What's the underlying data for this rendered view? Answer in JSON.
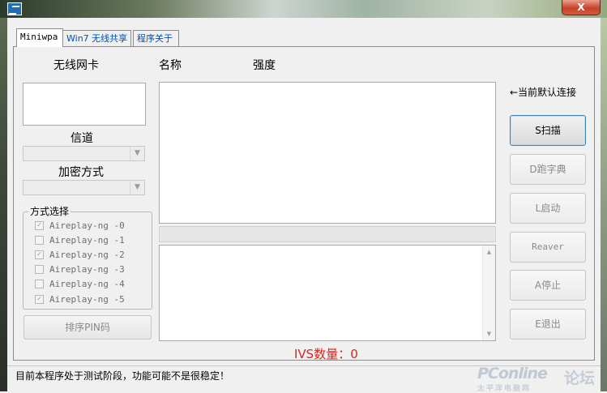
{
  "window": {
    "close_label": "X"
  },
  "tabs": [
    {
      "label": "Miniwpa"
    },
    {
      "label": "Win7 无线共享"
    },
    {
      "label": "程序关于"
    }
  ],
  "left": {
    "adapter_label": "无线网卡",
    "channel_label": "信道",
    "encryption_label": "加密方式",
    "mode_group_title": "方式选择",
    "modes": [
      {
        "label": "Aireplay-ng -0",
        "checked": true
      },
      {
        "label": "Aireplay-ng -1",
        "checked": false
      },
      {
        "label": "Aireplay-ng -2",
        "checked": true
      },
      {
        "label": "Aireplay-ng -3",
        "checked": false
      },
      {
        "label": "Aireplay-ng -4",
        "checked": false
      },
      {
        "label": "Aireplay-ng -5",
        "checked": true
      }
    ],
    "sort_pin_button": "排序PIN码"
  },
  "list": {
    "col_name": "名称",
    "col_strength": "强度"
  },
  "right": {
    "default_conn_note": "←当前默认连接",
    "buttons": {
      "scan": "S扫描",
      "dictionary": "D跑字典",
      "start": "L启动",
      "reaver": "Reaver",
      "stop": "A停止",
      "exit": "E退出"
    }
  },
  "ivs": {
    "label": "IVS数量：0"
  },
  "status": {
    "text": "目前本程序处于测试阶段，功能可能不是很稳定！"
  },
  "watermark": {
    "line1": "PConline",
    "line2": "论坛",
    "line3": "太平洋电脑网"
  }
}
